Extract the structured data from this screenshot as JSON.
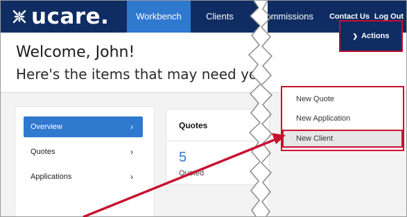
{
  "brand": {
    "name": "ucare."
  },
  "nav": {
    "items": [
      {
        "label": "Workbench",
        "active": true
      },
      {
        "label": "Clients",
        "active": false
      },
      {
        "label": "Commissions",
        "active": false
      },
      {
        "label": "Contact Us",
        "active": false
      },
      {
        "label": "Log Out",
        "active": false
      }
    ]
  },
  "welcome": {
    "title": "Welcome, John!",
    "subtitle": "Here's the items that may need yo"
  },
  "actions": {
    "label": "Actions",
    "menu": [
      {
        "label": "New Quote"
      },
      {
        "label": "New Application"
      },
      {
        "label": "New Client",
        "highlighted": true
      }
    ]
  },
  "sidebar": {
    "items": [
      {
        "label": "Overview",
        "active": true
      },
      {
        "label": "Quotes",
        "active": false
      },
      {
        "label": "Applications",
        "active": false
      }
    ]
  },
  "quotes_card": {
    "title": "Quotes",
    "count": "5",
    "count_label": "Quoted"
  },
  "colors": {
    "navy": "#0f2d63",
    "accent_blue": "#2f79ce",
    "callout_red": "#c8102e"
  }
}
